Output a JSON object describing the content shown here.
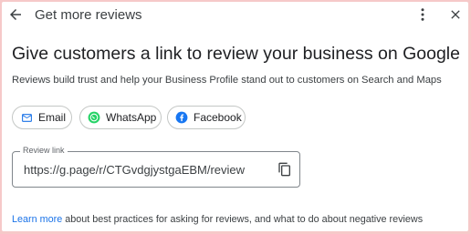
{
  "header": {
    "title": "Get more reviews",
    "back_icon": "back-arrow-icon",
    "more_icon": "more-vert-icon",
    "close_icon": "close-icon"
  },
  "main": {
    "heading": "Give customers a link to review your business on Google",
    "subtext": "Reviews build trust and help your Business Profile stand out to customers on Search and Maps"
  },
  "share": {
    "chips": [
      {
        "label": "Email",
        "icon": "email-icon",
        "color": "#1a73e8"
      },
      {
        "label": "WhatsApp",
        "icon": "whatsapp-icon",
        "color": "#25d366"
      },
      {
        "label": "Facebook",
        "icon": "facebook-icon",
        "color": "#1877f2"
      }
    ]
  },
  "review_link": {
    "label": "Review link",
    "value": "https://g.page/r/CTGvdgjystgaEBM/review",
    "copy_icon": "copy-icon"
  },
  "footer": {
    "link_text": "Learn more",
    "text": " about best practices for asking for reviews, and what to do about negative reviews"
  },
  "colors": {
    "frame_border": "#f6c9c9",
    "link": "#1a73e8"
  }
}
